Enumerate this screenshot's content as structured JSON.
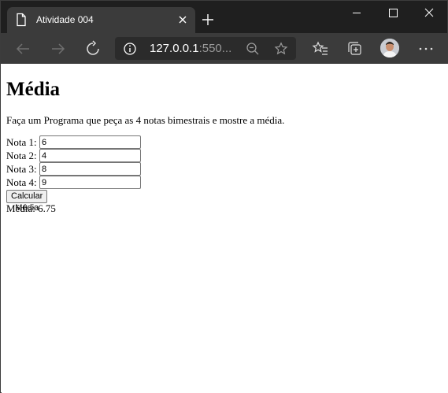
{
  "browser": {
    "tab_title": "Atividade 004",
    "url_host": "127.0.0.1",
    "url_rest": ":550..."
  },
  "page": {
    "title": "Média",
    "description": "Faça um Programa que peça as 4 notas bimestrais e mostre a média.",
    "fields": [
      {
        "label": "Nota 1:",
        "value": "6"
      },
      {
        "label": "Nota 2:",
        "value": "4"
      },
      {
        "label": "Nota 3:",
        "value": "8"
      },
      {
        "label": "Nota 4:",
        "value": "9"
      }
    ],
    "button_label": "Calcular Média",
    "result": "Média: 6.75"
  },
  "icons": {
    "tab": "page-icon",
    "close_tab": "close-icon",
    "new_tab": "plus-icon",
    "back": "arrow-left-icon",
    "forward": "arrow-right-icon",
    "refresh": "refresh-icon",
    "info": "info-icon",
    "zoom": "zoom-out-icon",
    "favorite": "star-icon",
    "favorites": "favorites-icon",
    "collections": "collections-icon",
    "profile": "avatar",
    "more": "more-icon"
  },
  "colors": {
    "titlebar": "#1f1f1f",
    "toolbar": "#3b3b3b",
    "urlbar": "#2b2b2b",
    "page_background": "#ffffff"
  }
}
